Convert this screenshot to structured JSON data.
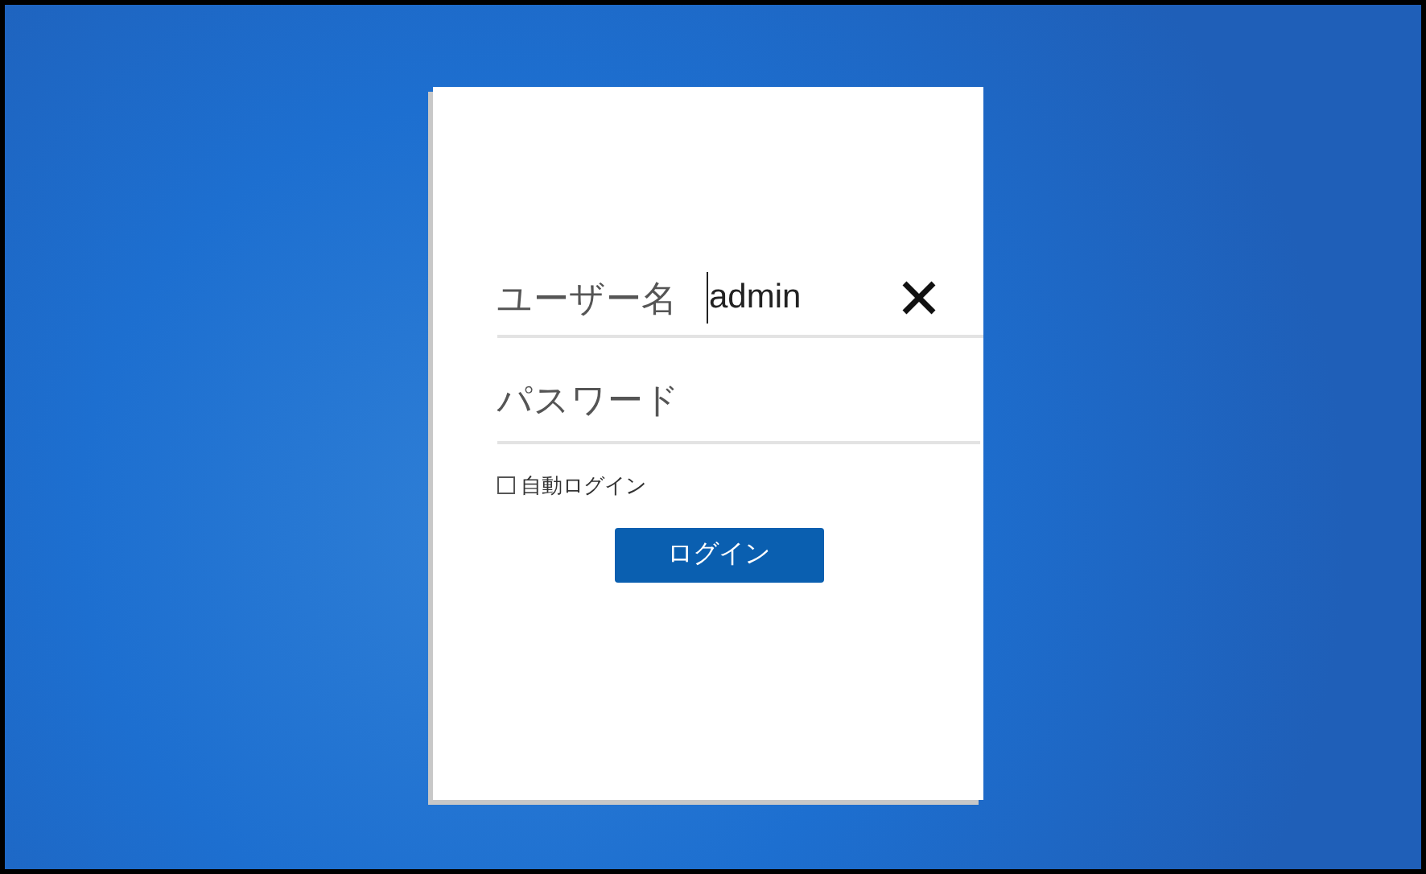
{
  "login_form": {
    "username": {
      "label": "ユーザー名",
      "value": "admin"
    },
    "password": {
      "placeholder": "パスワード"
    },
    "auto_login": {
      "label": "自動ログイン",
      "checked": false
    },
    "login_button": {
      "label": "ログイン"
    }
  }
}
